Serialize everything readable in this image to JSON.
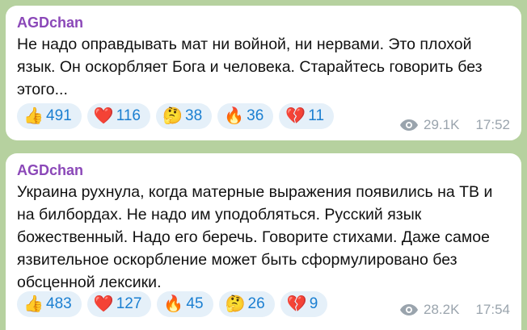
{
  "messages": [
    {
      "sender": "AGDchan",
      "text": "Не надо оправдывать мат ни войной, ни нервами. Это плохой язык. Он оскорбляет Бога и человека. Старайтесь говорить без этого...",
      "reactions": [
        {
          "emoji": "👍",
          "icon": "thumbs-up-icon",
          "count": "491"
        },
        {
          "emoji": "❤️",
          "icon": "heart-icon",
          "count": "116"
        },
        {
          "emoji": "🤔",
          "icon": "thinking-face-icon",
          "count": "38"
        },
        {
          "emoji": "🔥",
          "icon": "fire-icon",
          "count": "36"
        },
        {
          "emoji": "💔",
          "icon": "broken-heart-icon",
          "count": "11"
        }
      ],
      "views": "29.1K",
      "time": "17:52"
    },
    {
      "sender": "AGDchan",
      "text": "Украина рухнула, когда матерные выражения появились на ТВ и на билбордах. Не надо им уподобляться. Русский язык божественный. Надо его беречь. Говорите стихами. Даже самое язвительное оскорбление может быть сформулировано без обсценной лексики.",
      "reactions": [
        {
          "emoji": "👍",
          "icon": "thumbs-up-icon",
          "count": "483"
        },
        {
          "emoji": "❤️",
          "icon": "heart-icon",
          "count": "127"
        },
        {
          "emoji": "🔥",
          "icon": "fire-icon",
          "count": "45"
        },
        {
          "emoji": "🤔",
          "icon": "thinking-face-icon",
          "count": "26"
        },
        {
          "emoji": "💔",
          "icon": "broken-heart-icon",
          "count": "9"
        }
      ],
      "views": "28.2K",
      "time": "17:54"
    }
  ],
  "colors": {
    "chat_background": "#b6d19f",
    "sender_name": "#8b48b8",
    "reaction_chip": "#e5f0f9",
    "reaction_count": "#1b7fd1",
    "meta_text": "#9aa4ad"
  }
}
